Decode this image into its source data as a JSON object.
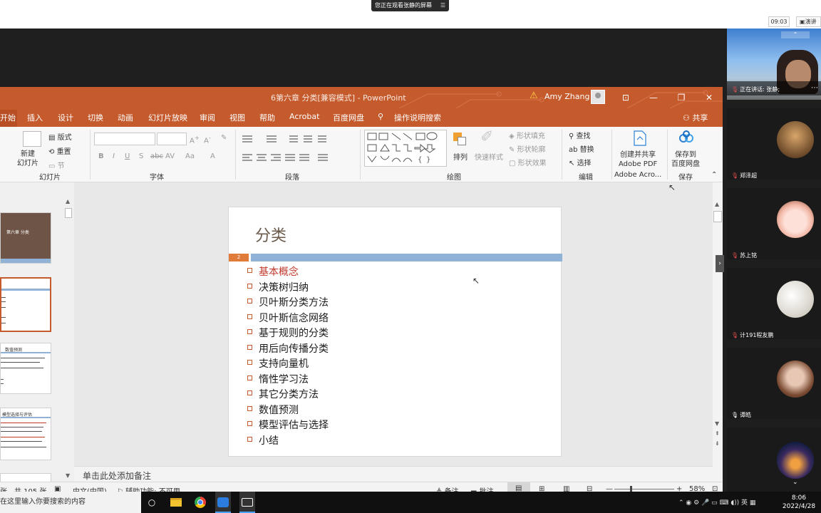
{
  "meeting": {
    "share_banner": "您正在观看张静的屏幕",
    "banner_menu": "☰",
    "time": "09:03",
    "speaker_view": "演讲"
  },
  "ppt": {
    "title": "6第六章 分类[兼容模式] - PowerPoint",
    "user_name": "Amy Zhang",
    "window_controls": [
      "⊡",
      "—",
      "❐",
      "✕"
    ],
    "tabs": [
      "开始",
      "插入",
      "设计",
      "切换",
      "动画",
      "幻灯片放映",
      "审阅",
      "视图",
      "帮助",
      "Acrobat",
      "百度网盘",
      "操作说明搜索"
    ],
    "share_label": "共享",
    "ribbon": {
      "slides_group": "幻灯片",
      "new_slide": "新建\n幻灯片",
      "layout": "版式",
      "reset": "重置",
      "section": "节",
      "font_group": "字体",
      "paragraph_group": "段落",
      "drawing_group": "绘图",
      "arrange": "排列",
      "quick_styles": "快速样式",
      "shape_fill": "形状填充",
      "shape_outline": "形状轮廓",
      "shape_effects": "形状效果",
      "editing_group": "编辑",
      "find": "查找",
      "replace": "替换",
      "select": "选择",
      "create_pdf": "创建并共享\nAdobe PDF",
      "acrobat_group": "Adobe Acro...",
      "save_baidu": "保存到\n百度网盘",
      "save_group": "保存"
    },
    "thumb1_title": "第六章 分类",
    "thumb3_title": "数值预测",
    "thumb4_title": "模型选择与评估"
  },
  "slide": {
    "title": "分类",
    "number": "2",
    "bullets": [
      "基本概念",
      "决策树归纳",
      "贝叶斯分类方法",
      "贝叶斯信念网络",
      "基于规则的分类",
      "用后向传播分类",
      "支持向量机",
      "惰性学习法",
      "其它分类方法",
      "数值预测",
      "模型评估与选择",
      "小结"
    ]
  },
  "notes_placeholder": "单击此处添加备注",
  "status": {
    "slide_count": "张，共 105 张",
    "language": "中文(中国)",
    "accessibility": "辅助功能: 不可用",
    "notes_btn": "备注",
    "comments_btn": "批注",
    "zoom": "58%"
  },
  "participants": {
    "speaking": "正在讲话: 张静;",
    "names": [
      "郑泽超",
      "苏上铭",
      "计191程友鹏",
      "谭皓"
    ]
  },
  "taskbar": {
    "search_placeholder": "在这里输入你要搜索的内容",
    "time": "8:06",
    "date": "2022/4/28",
    "ime": "英"
  },
  "colors": {
    "ppt_orange": "#c55a2c",
    "slide_bar": "#8fb2d6",
    "active_bullet": "#c0392b"
  }
}
